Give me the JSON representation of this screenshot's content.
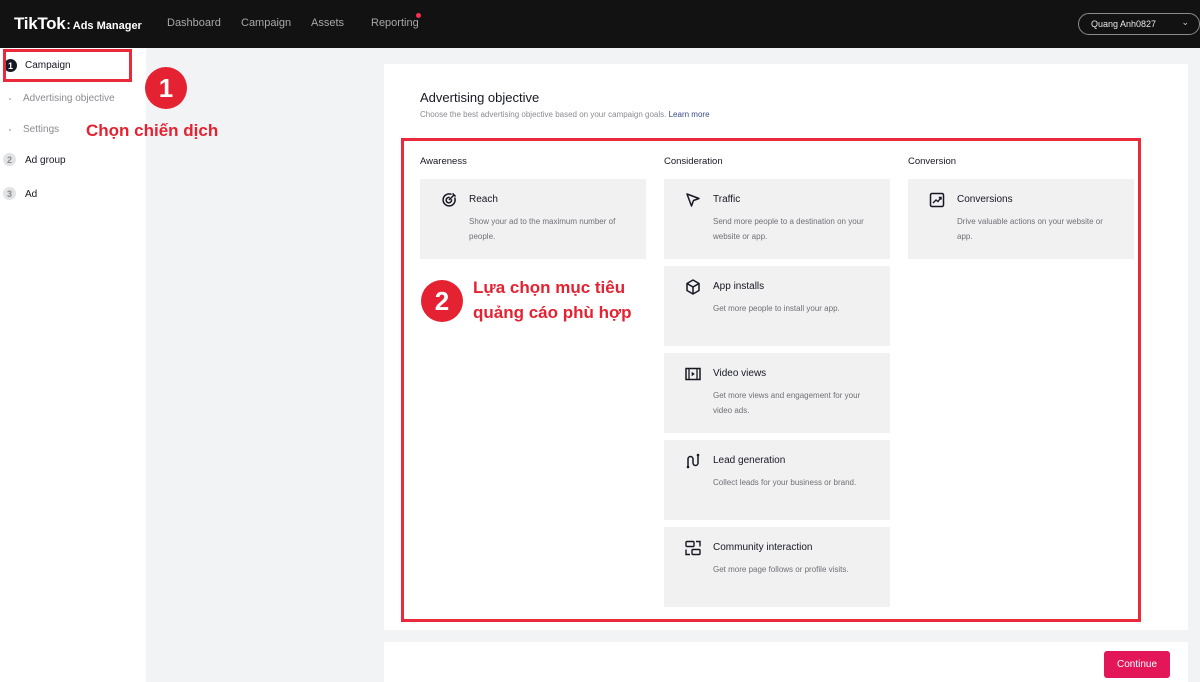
{
  "header": {
    "logo_main": "TikTok",
    "logo_sep": ":",
    "logo_sub": "Ads Manager",
    "nav": [
      "Dashboard",
      "Campaign",
      "Assets",
      "Reporting"
    ],
    "account": "Quang Anh0827"
  },
  "sidebar": {
    "steps": [
      {
        "num": "1",
        "label": "Campaign"
      },
      {
        "num": "2",
        "label": "Ad group"
      },
      {
        "num": "3",
        "label": "Ad"
      }
    ],
    "substeps": [
      "Advertising objective",
      "Settings"
    ]
  },
  "annotations": {
    "badge1": "1",
    "text1": "Chọn chiến dịch",
    "badge2": "2",
    "text2_line1": "Lựa chọn mục tiêu",
    "text2_line2": "quảng cáo phù hợp"
  },
  "objective": {
    "title": "Advertising objective",
    "description": "Choose the best advertising objective based on your campaign goals.",
    "learn_more": "Learn more",
    "columns": [
      "Awareness",
      "Consideration",
      "Conversion"
    ],
    "cards": [
      {
        "title": "Reach",
        "desc": "Show your ad to the maximum number of people."
      },
      {
        "title": "Traffic",
        "desc": "Send more people to a destination on your website or app."
      },
      {
        "title": "App installs",
        "desc": "Get more people to install your app."
      },
      {
        "title": "Video views",
        "desc": "Get more views and engagement for your video ads."
      },
      {
        "title": "Lead generation",
        "desc": "Collect leads for your business or brand."
      },
      {
        "title": "Community interaction",
        "desc": "Get more page follows or profile visits."
      },
      {
        "title": "Conversions",
        "desc": "Drive valuable actions on your website or app."
      }
    ]
  },
  "footer": {
    "continue_label": "Continue"
  },
  "colors": {
    "accent": "#e3165a",
    "annotation_red": "#e52231",
    "topbar": "#121212"
  }
}
